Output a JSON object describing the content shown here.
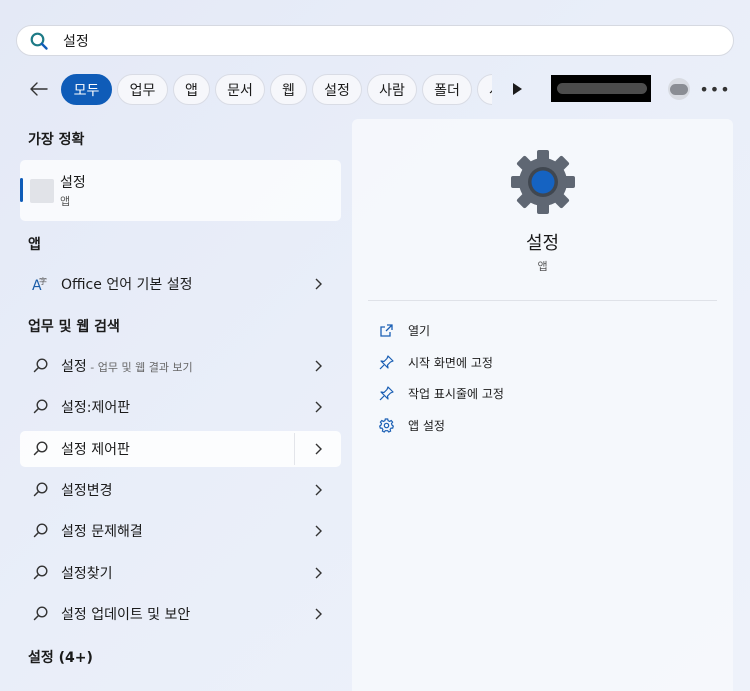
{
  "search": {
    "query": "설정"
  },
  "filters": {
    "chips": [
      "모두",
      "업무",
      "앱",
      "문서",
      "웹",
      "설정",
      "사람",
      "폴더",
      "사진"
    ],
    "active": "모두",
    "more_icon": "ellipsis-icon",
    "play_icon": "play-icon"
  },
  "best_match": {
    "heading": "가장 정확",
    "title": "설정",
    "subtitle": "앱"
  },
  "apps": {
    "heading": "앱",
    "items": [
      {
        "label": "Office 언어 기본 설정"
      }
    ]
  },
  "web": {
    "heading": "업무 및 웹 검색",
    "items": [
      {
        "label": "설정",
        "sub": " - 업무 및 웹 결과 보기"
      },
      {
        "label": "설정:제어판",
        "sub": ""
      },
      {
        "label": "설정 제어판",
        "sub": ""
      },
      {
        "label": "설정변경",
        "sub": ""
      },
      {
        "label": "설정 문제해결",
        "sub": ""
      },
      {
        "label": "설정찾기",
        "sub": ""
      },
      {
        "label": "설정 업데이트 및 보안",
        "sub": ""
      }
    ]
  },
  "settings_group": {
    "heading": "설정 (4+)"
  },
  "preview": {
    "title": "설정",
    "subtitle": "앱",
    "actions": [
      {
        "label": "열기",
        "icon": "open-external-icon"
      },
      {
        "label": "시작 화면에 고정",
        "icon": "pin-icon"
      },
      {
        "label": "작업 표시줄에 고정",
        "icon": "pin-icon"
      },
      {
        "label": "앱 설정",
        "icon": "gear-icon"
      }
    ]
  },
  "colors": {
    "accent": "#0f5cb8",
    "gear_outer": "#5f6773",
    "gear_center": "#1563c2"
  }
}
